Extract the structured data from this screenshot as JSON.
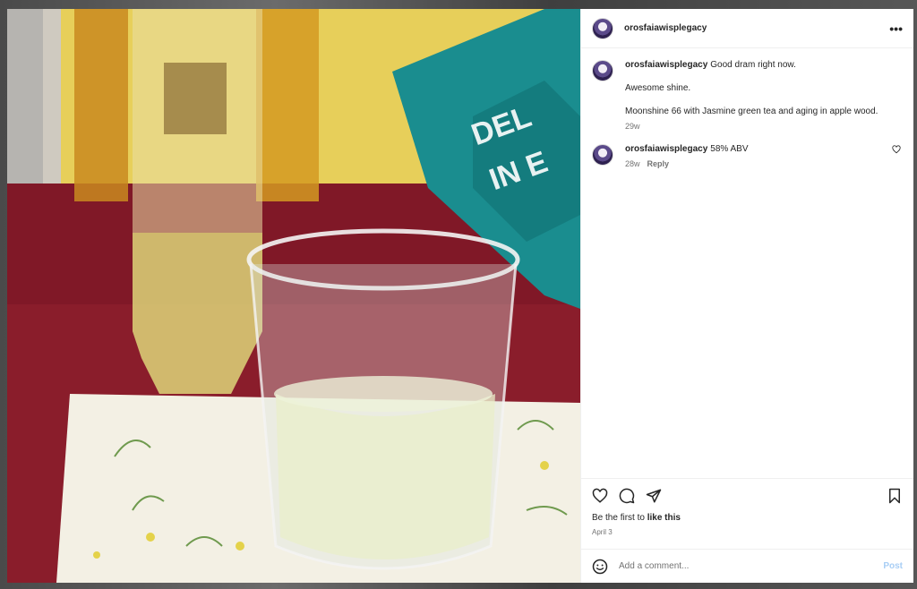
{
  "post": {
    "username": "orosfaiawisplegacy",
    "more_icon": "more-horizontal-icon"
  },
  "photo": {
    "description_icon": "photo"
  },
  "comments": [
    {
      "username": "orosfaiawisplegacy",
      "lines": [
        "Good dram right now.",
        "Awesome shine.",
        "Moonshine 66 with Jasmine green tea and aging in apple wood."
      ],
      "age": "29w"
    },
    {
      "username": "orosfaiawisplegacy",
      "text": "58% ABV",
      "age": "28w",
      "reply_label": "Reply"
    }
  ],
  "actions": {
    "likes_prefix": "Be the first to ",
    "likes_link": "like this",
    "date": "April 3"
  },
  "composer": {
    "placeholder": "Add a comment...",
    "post_label": "Post"
  },
  "colors": {
    "link_blue": "#a8cef5",
    "muted_text": "#737373",
    "border": "#efefef"
  }
}
